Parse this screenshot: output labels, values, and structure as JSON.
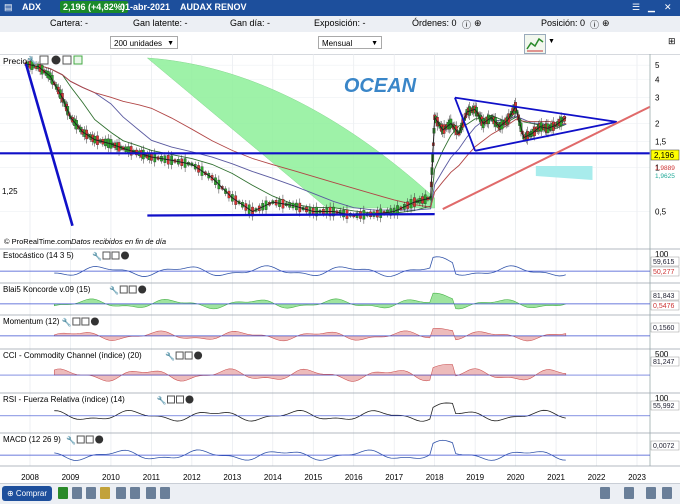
{
  "titlebar": {
    "ticker": "ADX",
    "price_badge": "2,196 (+4,82%)",
    "date": "01-abr-2021",
    "name": "AUDAX RENOV"
  },
  "infobar": {
    "cartera": "Cartera: -",
    "gan_latente": "Gan latente: -",
    "gan_dia": "Gan día: -",
    "exposicion": "Exposición: -",
    "ordenes": "Órdenes: 0",
    "posicion": "Posición: 0"
  },
  "controls": {
    "units_select": "200 unidades",
    "period_select": "Mensual"
  },
  "colors": {
    "header_blue": "#1d4f9c",
    "price_badge_green": "#1a8a2a",
    "ocean_text": "#3a86c8",
    "trendline": "#1010c8",
    "support_red": "#e06a6a",
    "cloud_green": "#8ef09a",
    "cloud_cyan": "#a8ecec"
  },
  "chart_data": [
    {
      "type": "line",
      "panel": "Precio",
      "annotation": "OCEAN",
      "footer_left": "© ProRealTime.com",
      "footer_right": "Datos recibidos en fin de día",
      "x_ticks": [
        "2008",
        "2009",
        "2010",
        "2011",
        "2012",
        "2013",
        "2014",
        "2015",
        "2016",
        "2017",
        "2018",
        "2019",
        "2020",
        "2021",
        "2022",
        "2023"
      ],
      "y_scale": "log",
      "y_ticks": [
        "5",
        "4",
        "3",
        "2",
        "1,5",
        "1",
        "0,5"
      ],
      "ylim": [
        0.3,
        5.6
      ],
      "y_extra_labels": [
        "1,25"
      ],
      "last_price_label": "2,196",
      "price_labels_right": [
        "1,9889",
        "1,9625"
      ],
      "series": [
        {
          "values_x": [
            2007.9,
            2008.2,
            2008.5,
            2008.8,
            2009.0,
            2009.3,
            2009.6,
            2010.0,
            2010.3,
            2010.7,
            2011.0,
            2011.5,
            2012.0,
            2012.5,
            2013.0,
            2013.5,
            2014.0,
            2014.5,
            2015.0,
            2015.5,
            2016.0,
            2016.5,
            2017.0,
            2017.5,
            2017.9,
            2018.0,
            2018.2,
            2018.4,
            2018.6,
            2018.8,
            2019.0,
            2019.2,
            2019.4,
            2019.6,
            2019.8,
            2020.0,
            2020.2,
            2020.4,
            2020.6,
            2020.8,
            2021.0,
            2021.25
          ],
          "values_y": [
            5.1,
            4.9,
            4.2,
            3.0,
            2.2,
            1.75,
            1.55,
            1.45,
            1.35,
            1.25,
            1.18,
            1.12,
            1.05,
            0.85,
            0.62,
            0.5,
            0.58,
            0.55,
            0.5,
            0.5,
            0.47,
            0.48,
            0.5,
            0.58,
            0.62,
            2.2,
            1.8,
            2.0,
            1.7,
            2.4,
            2.5,
            2.0,
            2.2,
            1.9,
            2.1,
            2.6,
            1.6,
            1.7,
            1.9,
            1.85,
            1.95,
            2.196
          ]
        }
      ]
    },
    {
      "type": "line",
      "panel": "Estocástico (14 3 5)",
      "y_ticks": [
        "100"
      ],
      "value_labels": [
        "59,615",
        "50,277"
      ]
    },
    {
      "type": "area",
      "panel": "Blai5 Koncorde v.09 (15)",
      "value_labels": [
        "81,843",
        "0,5476"
      ]
    },
    {
      "type": "area",
      "panel": "Momentum (12)",
      "value_labels": [
        "0,1560"
      ]
    },
    {
      "type": "area",
      "panel": "CCI - Commodity Channel (índice) (20)",
      "y_ticks": [
        "500"
      ],
      "value_labels": [
        "81,247"
      ]
    },
    {
      "type": "line",
      "panel": "RSI - Fuerza Relativa (índice) (14)",
      "y_ticks": [
        "100"
      ],
      "value_labels": [
        "55,992"
      ]
    },
    {
      "type": "line",
      "panel": "MACD (12 26 9)",
      "value_labels": [
        "0,0072"
      ]
    }
  ],
  "bottombar": {
    "buy_button": "Comprar"
  }
}
